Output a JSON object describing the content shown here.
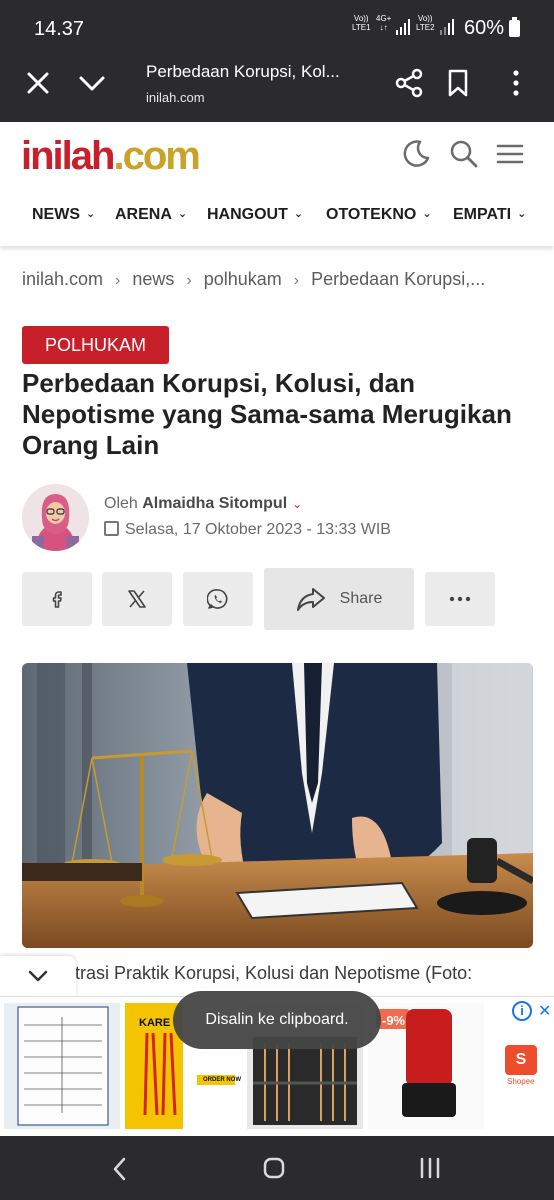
{
  "status_bar": {
    "time": "14.37",
    "sim1": "LTE1",
    "sim1_top": "Vo))",
    "sim1_net": "4G+",
    "sim2": "LTE2",
    "sim2_top": "Vo))",
    "battery": "60%"
  },
  "browser": {
    "title": "Perbedaan Korupsi, Kol...",
    "host": "inilah.com",
    "icons": [
      "close-icon",
      "chevron-down-icon",
      "share-icon",
      "bookmark-icon",
      "more-vert-icon"
    ]
  },
  "site": {
    "logo_left": "inilah",
    "logo_dot": ".",
    "logo_right": "com",
    "brand_red": "#c8202a",
    "brand_gold": "#c9a227",
    "nav": [
      {
        "label": "NEWS"
      },
      {
        "label": "ARENA"
      },
      {
        "label": "HANGOUT"
      },
      {
        "label": "OTOTEKNO"
      },
      {
        "label": "EMPATI"
      }
    ],
    "header_icons": [
      "moon-icon",
      "search-icon",
      "menu-icon"
    ]
  },
  "breadcrumb": [
    "inilah.com",
    "news",
    "polhukam",
    "Perbedaan Korupsi,..."
  ],
  "article": {
    "category": "POLHUKAM",
    "headline": "Perbedaan Korupsi, Kolusi, dan Nepotisme yang Sama-sama Merugikan Orang Lain",
    "author_prefix": "Oleh",
    "author": "Almaidha Sitompul",
    "date": "Selasa, 17 Oktober 2023 - 13:33 WIB",
    "share_label": "Share",
    "caption": "trasi Praktik Korupsi, Kolusi dan Nepotisme (Foto:"
  },
  "share_icons": [
    "facebook-icon",
    "x-icon",
    "whatsapp-icon",
    "share-arrow-icon",
    "more-horiz-icon"
  ],
  "ads": {
    "info": "i",
    "close": "✕",
    "discount": "-9%",
    "store": "Shopee",
    "brand_text": "KARE",
    "order_text": "ORDER NOW"
  },
  "toast": "Disalin ke clipboard.",
  "nav_bar": [
    "back-icon",
    "home-icon",
    "recents-icon"
  ]
}
